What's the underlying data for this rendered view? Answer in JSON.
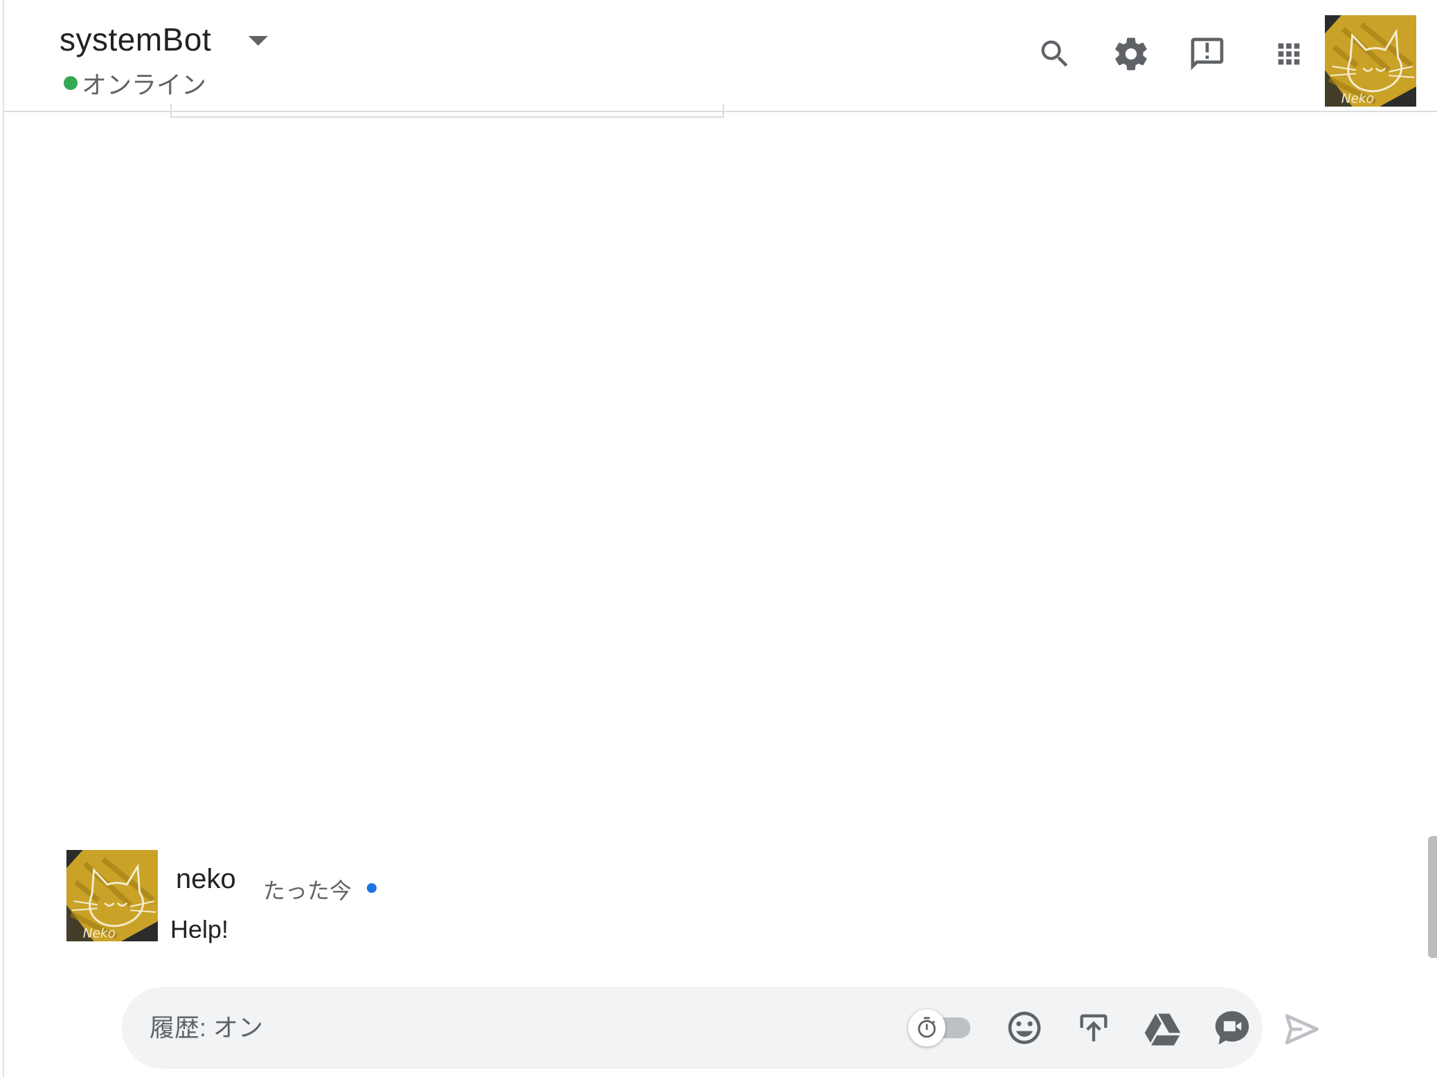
{
  "header": {
    "room_name": "systemBot",
    "presence_status": "オンライン",
    "presence_color": "#34a853",
    "icons": [
      "search-icon",
      "settings-gear-icon",
      "feedback-icon",
      "apps-grid-icon"
    ]
  },
  "message": {
    "author": "neko",
    "time": "たった今",
    "text": "Help!",
    "unread_dot_color": "#1a73e8"
  },
  "composer": {
    "placeholder": "履歴: オン",
    "icons": [
      "timer-icon",
      "emoji-icon",
      "upload-icon",
      "drive-icon",
      "video-meet-icon",
      "send-icon"
    ]
  },
  "avatar": {
    "signature": "Neko"
  },
  "colors": {
    "accent_blue": "#1a73e8",
    "icon_gray": "#5f6368",
    "avatar_gold": "#c9a227"
  }
}
